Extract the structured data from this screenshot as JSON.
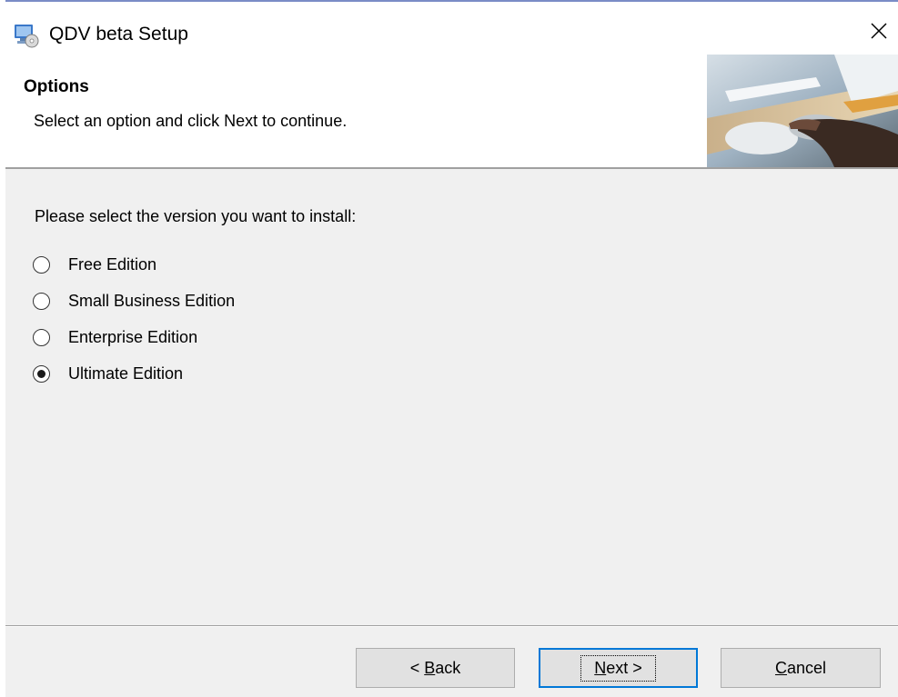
{
  "window": {
    "title": "QDV beta Setup"
  },
  "header": {
    "title": "Options",
    "description": "Select an option and click Next to continue."
  },
  "body": {
    "prompt": "Please select the version you want to install:",
    "options": [
      {
        "label": "Free Edition",
        "selected": false
      },
      {
        "label": "Small Business Edition",
        "selected": false
      },
      {
        "label": "Enterprise Edition",
        "selected": false
      },
      {
        "label": "Ultimate Edition",
        "selected": true
      }
    ]
  },
  "buttons": {
    "back": {
      "prefix": "< ",
      "accel": "B",
      "rest": "ack"
    },
    "next": {
      "accel": "N",
      "rest": "ext >"
    },
    "cancel": {
      "accel": "C",
      "rest": "ancel"
    }
  },
  "colors": {
    "focus_border": "#0078d7",
    "body_bg": "#f0f0f0",
    "button_bg": "#e1e1e1"
  },
  "icons": {
    "app": "installer-icon",
    "close": "close-icon",
    "header_image": "office-desk-photo"
  }
}
